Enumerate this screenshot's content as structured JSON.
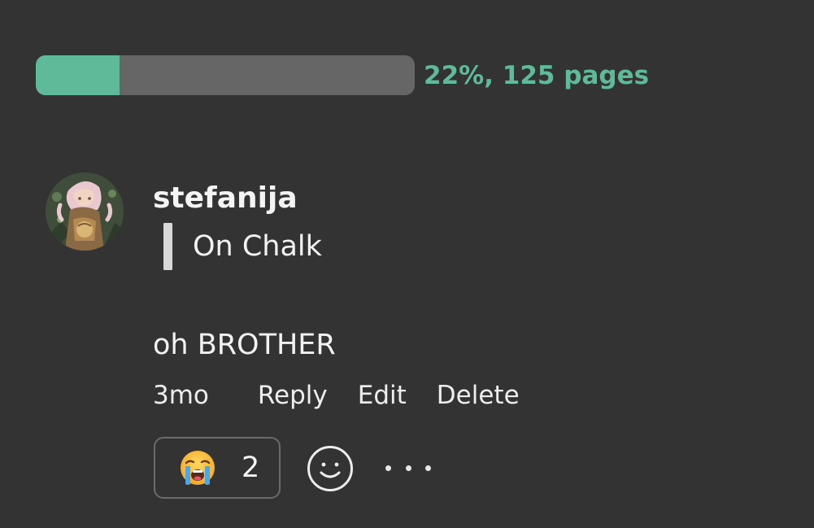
{
  "progress": {
    "percent": 22,
    "label": "22%, 125 pages",
    "fill_color": "#5fba99",
    "track_color": "#666666"
  },
  "comment": {
    "avatar_icon": "user-avatar-illustration",
    "username": "stefanija",
    "quote": "On Chalk",
    "body": "oh BROTHER",
    "time": "3mo",
    "actions": {
      "reply": "Reply",
      "edit": "Edit",
      "delete": "Delete"
    },
    "reaction": {
      "emoji_icon": "loudly-crying-face-icon",
      "count": "2"
    },
    "add_reaction_icon": "smiley-face-icon",
    "more_icon": "more-options-icon"
  },
  "colors": {
    "background": "#333333",
    "accent": "#5fba99",
    "text": "#f2f2f2"
  }
}
